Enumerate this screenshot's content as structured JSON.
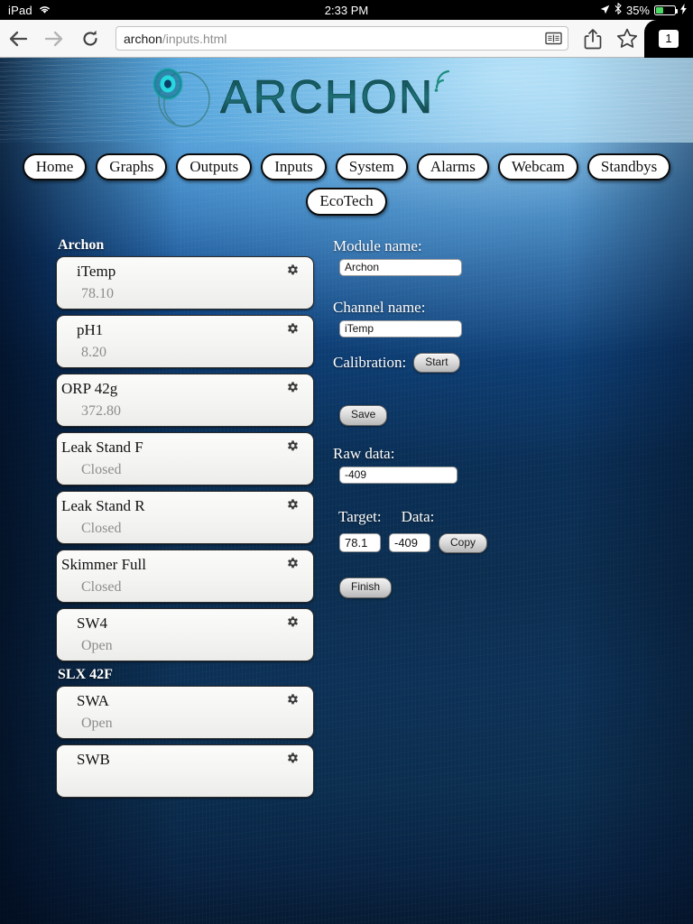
{
  "status_bar": {
    "device": "iPad",
    "wifi_icon": "wifi-icon",
    "time": "2:33 PM",
    "location_icon": "location-arrow-icon",
    "bluetooth_icon": "bluetooth-icon",
    "battery_percent": "35%",
    "battery_level": 35,
    "charging_icon": "lightning-bolt-icon"
  },
  "browser": {
    "back_icon": "back-arrow-icon",
    "forward_icon": "forward-arrow-icon",
    "reload_icon": "reload-icon",
    "url_host": "archon",
    "url_path": "/inputs.html",
    "reader_icon": "reader-view-icon",
    "share_icon": "share-icon",
    "bookmark_icon": "bookmark-star-icon",
    "tab_count": "1"
  },
  "banner": {
    "logo_text": "ARCHON",
    "logo_mark": "archon-circle-logo",
    "signal_icon": "wifi-signal-arcs-icon"
  },
  "nav": {
    "row1": [
      {
        "label": "Home"
      },
      {
        "label": "Graphs"
      },
      {
        "label": "Outputs"
      },
      {
        "label": "Inputs"
      },
      {
        "label": "System"
      },
      {
        "label": "Alarms"
      },
      {
        "label": "Webcam"
      },
      {
        "label": "Standbys"
      }
    ],
    "row2": [
      {
        "label": "EcoTech"
      }
    ]
  },
  "inputs_list": {
    "groups": [
      {
        "header": "Archon",
        "items": [
          {
            "name": "iTemp",
            "value": "78.10",
            "indent": true,
            "gear_icon": "gear-icon"
          },
          {
            "name": "pH1",
            "value": "8.20",
            "indent": true,
            "gear_icon": "gear-icon"
          },
          {
            "name": "ORP 42g",
            "value": "372.80",
            "indent": false,
            "gear_icon": "gear-icon"
          },
          {
            "name": "Leak Stand F",
            "value": "Closed",
            "indent": false,
            "gear_icon": "gear-icon"
          },
          {
            "name": "Leak Stand R",
            "value": "Closed",
            "indent": false,
            "gear_icon": "gear-icon"
          },
          {
            "name": "Skimmer Full",
            "value": "Closed",
            "indent": false,
            "gear_icon": "gear-icon"
          },
          {
            "name": "SW4",
            "value": "Open",
            "indent": true,
            "gear_icon": "gear-icon"
          }
        ]
      },
      {
        "header": "SLX 42F",
        "items": [
          {
            "name": "SWA",
            "value": "Open",
            "indent": true,
            "gear_icon": "gear-icon"
          },
          {
            "name": "SWB",
            "value": "",
            "indent": true,
            "gear_icon": "gear-icon"
          }
        ]
      }
    ]
  },
  "form": {
    "module_name_label": "Module name:",
    "module_name_value": "Archon",
    "channel_name_label": "Channel name:",
    "channel_name_value": "iTemp",
    "calibration_label": "Calibration:",
    "start_button": "Start",
    "save_button": "Save",
    "raw_data_label": "Raw data:",
    "raw_data_value": "-409",
    "target_label": "Target:",
    "data_label": "Data:",
    "target_value": "78.1",
    "data_value": "-409",
    "copy_button": "Copy",
    "finish_button": "Finish"
  },
  "colors": {
    "page_top": "#3c90cc",
    "page_bottom": "#061b33",
    "card_bg": "#f4f4f2",
    "card_value_text": "#8d8d8d",
    "battery_green": "#4cd964",
    "logo_teal": "#1a6f74"
  }
}
